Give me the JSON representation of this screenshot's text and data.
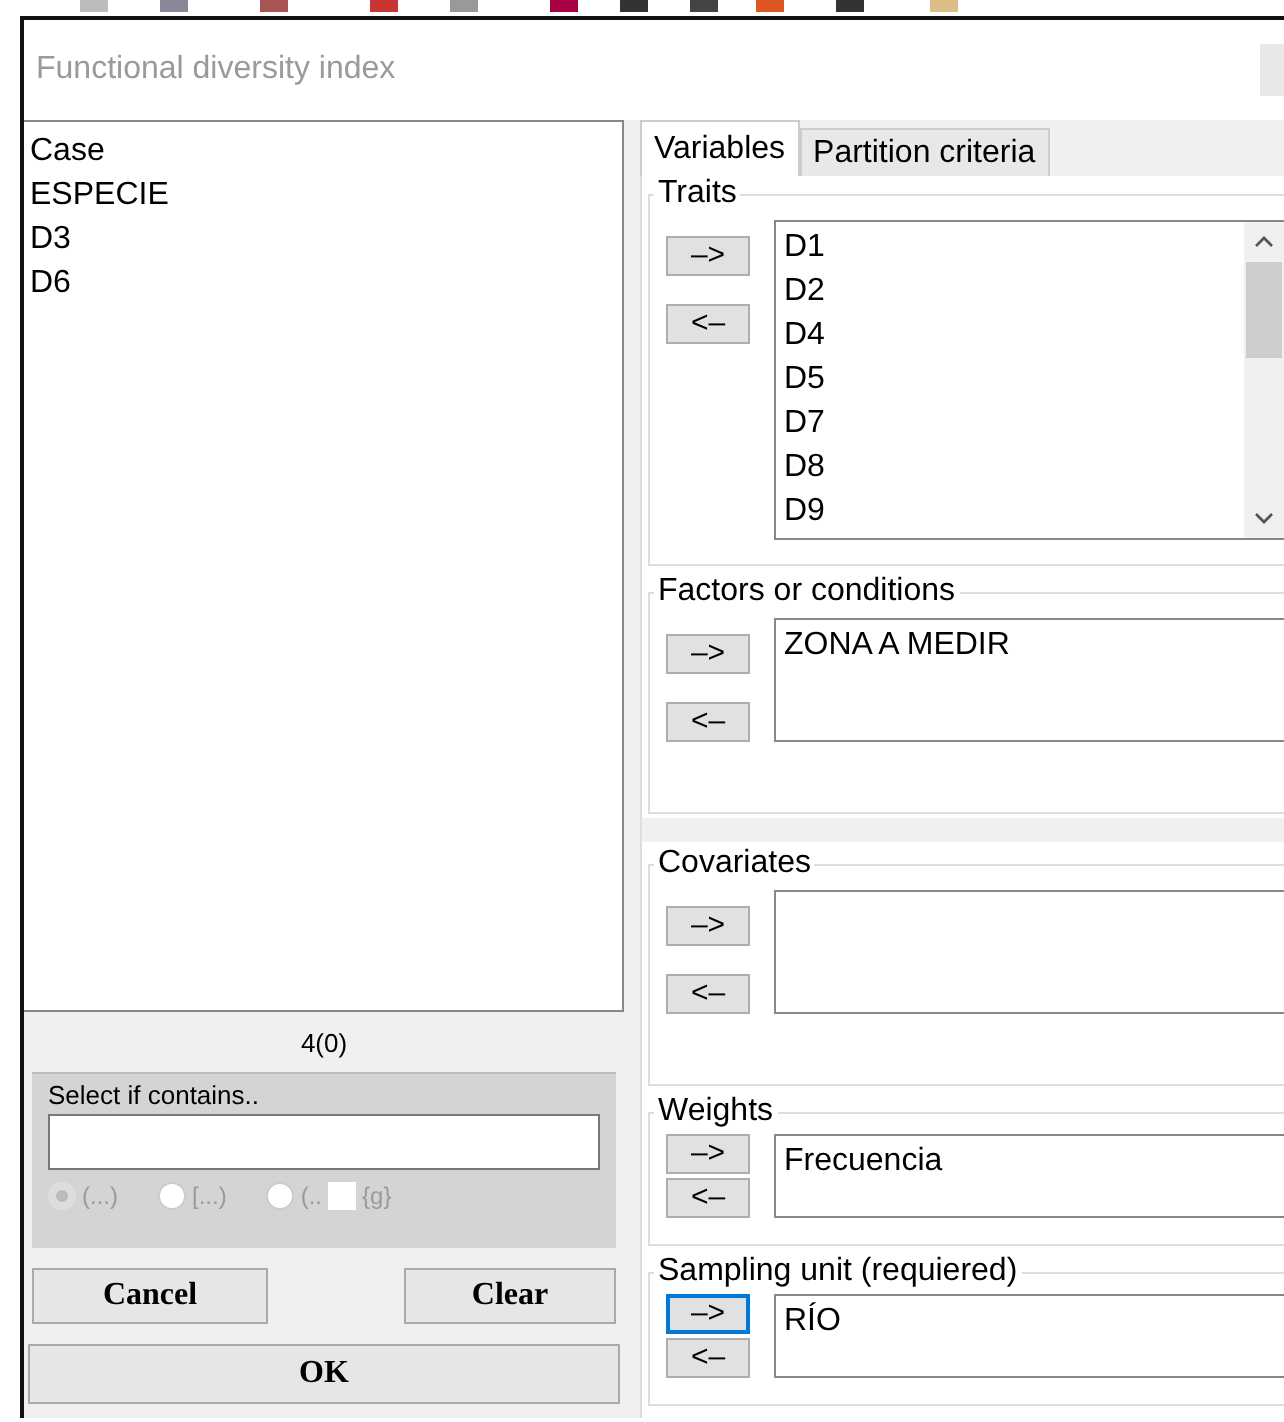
{
  "window": {
    "title": "Functional diversity index"
  },
  "variables": [
    "Case",
    "ESPECIE",
    "D3",
    "D6"
  ],
  "count": "4(0)",
  "filter": {
    "label": "Select if contains..",
    "disabled": true,
    "options": [
      {
        "label": "(...)",
        "selected": true
      },
      {
        "label": "[...)",
        "selected": false
      },
      {
        "label": "(..",
        "suffix": "{g}",
        "selected": false
      }
    ]
  },
  "buttons": {
    "cancel": "Cancel",
    "clear": "Clear",
    "ok": "OK"
  },
  "tabs": [
    {
      "label": "Variables",
      "selected": true
    },
    {
      "label": "Partition criteria",
      "selected": false
    }
  ],
  "groups": [
    {
      "kind": "large",
      "title": "Traits",
      "add": {
        "label": "–>",
        "focused": false
      },
      "remove": {
        "label": "<–"
      },
      "items": [
        "D1",
        "D2",
        "D4",
        "D5",
        "D7",
        "D8",
        "D9"
      ]
    },
    {
      "kind": "medium",
      "title": "Factors or conditions",
      "add": {
        "label": "–>",
        "focused": false
      },
      "remove": {
        "label": "<–"
      },
      "items": [
        "ZONA A MEDIR"
      ]
    },
    {
      "kind": "medium",
      "title": "Covariates",
      "add": {
        "label": "–>",
        "focused": false
      },
      "remove": {
        "label": "<–"
      }
    },
    {
      "kind": "small",
      "title": "Weights",
      "add": {
        "label": "–>",
        "focused": false
      },
      "remove": {
        "label": "<–"
      },
      "items": [
        "Frecuencia"
      ]
    },
    {
      "kind": "small",
      "title": "Sampling unit (requiered)",
      "add": {
        "label": "–>",
        "focused": true
      },
      "remove": {
        "label": "<–"
      },
      "items": [
        "RÍO"
      ]
    }
  ]
}
